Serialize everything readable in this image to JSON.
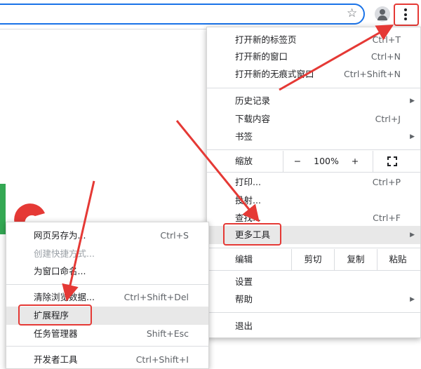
{
  "main_menu": {
    "new_tab": {
      "label": "打开新的标签页",
      "shortcut": "Ctrl+T"
    },
    "new_window": {
      "label": "打开新的窗口",
      "shortcut": "Ctrl+N"
    },
    "new_incognito": {
      "label": "打开新的无痕式窗口",
      "shortcut": "Ctrl+Shift+N"
    },
    "history": {
      "label": "历史记录"
    },
    "downloads": {
      "label": "下载内容",
      "shortcut": "Ctrl+J"
    },
    "bookmarks": {
      "label": "书签"
    },
    "zoom": {
      "label": "缩放",
      "minus": "−",
      "value": "100%",
      "plus": "+"
    },
    "print": {
      "label": "打印...",
      "shortcut": "Ctrl+P"
    },
    "cast": {
      "label": "投射..."
    },
    "find": {
      "label": "查找...",
      "shortcut": "Ctrl+F"
    },
    "more_tools": {
      "label": "更多工具"
    },
    "edit": {
      "label": "编辑",
      "cut": "剪切",
      "copy": "复制",
      "paste": "粘贴"
    },
    "settings": {
      "label": "设置"
    },
    "help": {
      "label": "帮助"
    },
    "exit": {
      "label": "退出"
    }
  },
  "sub_menu": {
    "save_page": {
      "label": "网页另存为...",
      "shortcut": "Ctrl+S"
    },
    "create_shortcut": {
      "label": "创建快捷方式..."
    },
    "name_window": {
      "label": "为窗口命名..."
    },
    "clear_data": {
      "label": "清除浏览数据...",
      "shortcut": "Ctrl+Shift+Del"
    },
    "extensions": {
      "label": "扩展程序"
    },
    "task_manager": {
      "label": "任务管理器",
      "shortcut": "Shift+Esc"
    },
    "dev_tools": {
      "label": "开发者工具",
      "shortcut": "Ctrl+Shift+I"
    }
  },
  "colors": {
    "accent": "#1a73e8",
    "annotation_red": "#e53935",
    "highlight": "#e8e8e8",
    "green": "#34a853"
  },
  "icons": {
    "star": "star-icon",
    "profile": "profile-icon",
    "menu": "kebab-menu-icon",
    "fullscreen": "fullscreen-icon",
    "submenu": "chevron-right-icon"
  }
}
